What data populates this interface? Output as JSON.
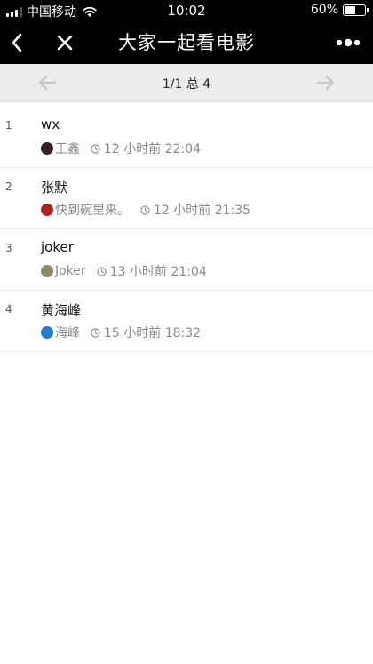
{
  "status_bar": {
    "carrier": "中国移动",
    "time": "10:02",
    "battery_percent": "60%",
    "battery_level": 0.6
  },
  "nav": {
    "title": "大家一起看电影",
    "back_icon": "chevron-left-icon",
    "close_icon": "close-icon",
    "more_icon": "more-dots-icon"
  },
  "pager": {
    "info": "1/1 总 4"
  },
  "posts": [
    {
      "num": "1",
      "title": "wx",
      "author": "王鑫",
      "time": "12 小时前 22:04",
      "avatar_color": "#3a1f1f"
    },
    {
      "num": "2",
      "title": "张默",
      "author": "快到碗里来。",
      "time": "12 小时前 21:35",
      "avatar_color": "#b22222"
    },
    {
      "num": "3",
      "title": "joker",
      "author": "Joker",
      "time": "13 小时前 21:04",
      "avatar_color": "#8f8a6a"
    },
    {
      "num": "4",
      "title": "黄海峰",
      "author": "海峰",
      "time": "15 小时前 18:32",
      "avatar_color": "#1e7fd0"
    }
  ]
}
